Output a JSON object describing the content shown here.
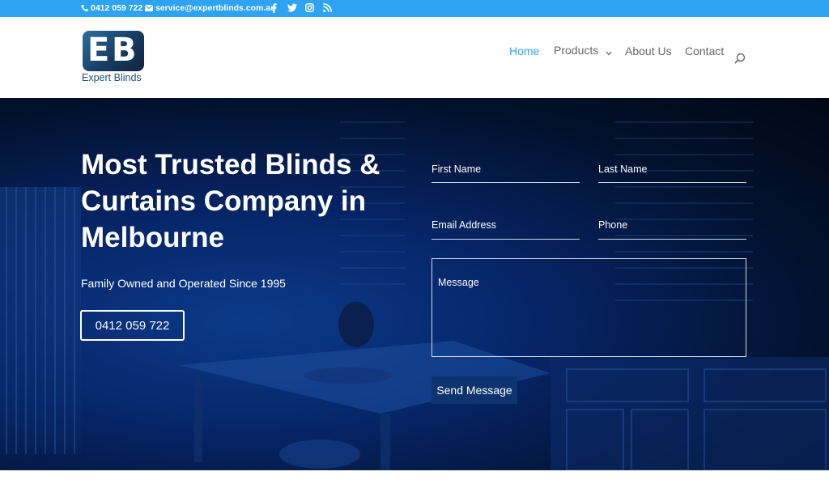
{
  "topbar": {
    "phone": "0412 059 722",
    "email": "service@expertblinds.com.au",
    "social_icons": [
      "facebook-icon",
      "twitter-icon",
      "instagram-icon",
      "rss-icon"
    ]
  },
  "header": {
    "logo_text": "Expert Blinds",
    "nav": [
      {
        "label": "Home",
        "active": true
      },
      {
        "label": "Products",
        "has_dropdown": true
      },
      {
        "label": "About Us"
      },
      {
        "label": "Contact"
      }
    ]
  },
  "hero": {
    "title": "Most Trusted Blinds & Curtains Company in Melbourne",
    "subtitle": "Family Owned and Operated Since 1995",
    "cta_label": "0412 059 722"
  },
  "form": {
    "first_name": "First Name",
    "last_name": "Last Name",
    "email": "Email Address",
    "phone": "Phone",
    "message": "Message",
    "submit_label": "Send Message"
  },
  "colors": {
    "accent": "#2ea3f2",
    "hero_overlay": "#062567",
    "button": "#0e3470"
  }
}
